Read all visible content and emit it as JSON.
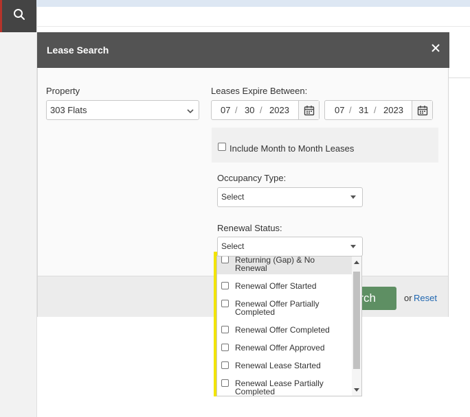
{
  "modal": {
    "title": "Lease Search",
    "property": {
      "label": "Property",
      "value": "303 Flats"
    },
    "expire": {
      "label": "Leases Expire Between:",
      "start": {
        "month": "07",
        "day": "30",
        "year": "2023"
      },
      "end": {
        "month": "07",
        "day": "31",
        "year": "2023"
      },
      "separator": "/"
    },
    "month_to_month": {
      "label": "Include Month to Month Leases",
      "checked": false
    },
    "occupancy": {
      "label": "Occupancy Type:",
      "value": "Select"
    },
    "renewal": {
      "label": "Renewal Status:",
      "value": "Select",
      "options": [
        {
          "line1": "Returning (Gap) & No",
          "line2": "Renewal"
        },
        {
          "line1": "Renewal Offer Started",
          "line2": ""
        },
        {
          "line1": "Renewal Offer Partially",
          "line2": "Completed"
        },
        {
          "line1": "Renewal Offer Completed",
          "line2": ""
        },
        {
          "line1": "Renewal Offer Approved",
          "line2": ""
        },
        {
          "line1": "Renewal Lease Started",
          "line2": ""
        },
        {
          "line1": "Renewal Lease Partially",
          "line2": "Completed"
        }
      ]
    },
    "footer": {
      "search_label_visible": "rch",
      "or_text": "or",
      "reset_label": "Reset"
    }
  },
  "colors": {
    "header_bg": "#535353",
    "search_button": "#5e8f63",
    "link": "#1f66b0",
    "highlight_marker": "#f2e400"
  }
}
